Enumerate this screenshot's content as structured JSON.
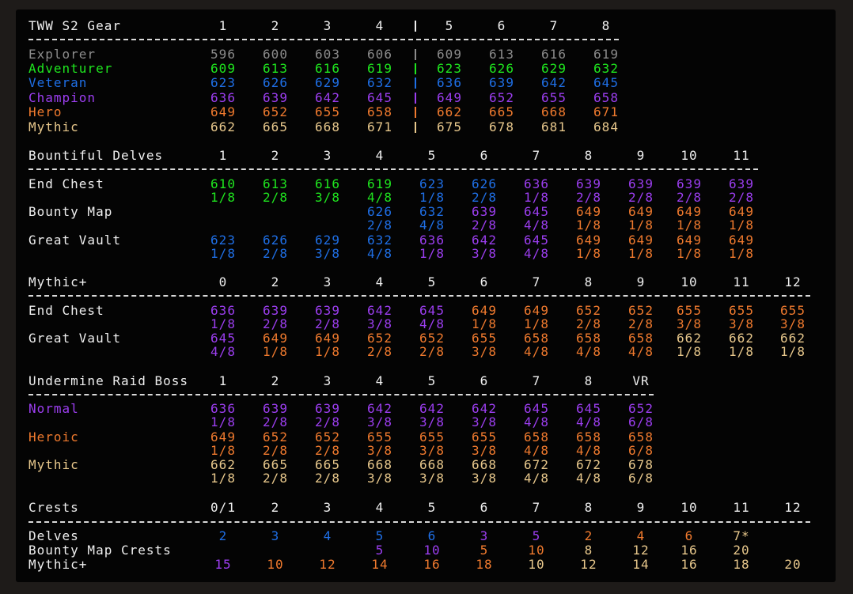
{
  "colors": {
    "header": "#efefef",
    "grey": "#8c8c8c",
    "green": "#1fe61f",
    "blue": "#1f6fe6",
    "purple": "#9c3ef0",
    "orange": "#f07a2e",
    "tan": "#e8c88c",
    "rule": "#d9d9d9"
  },
  "gear_table": {
    "title": "TWW S2 Gear",
    "columns": [
      "1",
      "2",
      "3",
      "4",
      "5",
      "6",
      "7",
      "8"
    ],
    "separator": "|",
    "rows": [
      {
        "label": "Explorer",
        "color": "grey",
        "values": [
          "596",
          "600",
          "603",
          "606",
          "609",
          "613",
          "616",
          "619"
        ]
      },
      {
        "label": "Adventurer",
        "color": "green",
        "values": [
          "609",
          "613",
          "616",
          "619",
          "623",
          "626",
          "629",
          "632"
        ]
      },
      {
        "label": "Veteran",
        "color": "blue",
        "values": [
          "623",
          "626",
          "629",
          "632",
          "636",
          "639",
          "642",
          "645"
        ]
      },
      {
        "label": "Champion",
        "color": "purple",
        "values": [
          "636",
          "639",
          "642",
          "645",
          "649",
          "652",
          "655",
          "658"
        ]
      },
      {
        "label": "Hero",
        "color": "orange",
        "values": [
          "649",
          "652",
          "655",
          "658",
          "662",
          "665",
          "668",
          "671"
        ]
      },
      {
        "label": "Mythic",
        "color": "tan",
        "values": [
          "662",
          "665",
          "668",
          "671",
          "675",
          "678",
          "681",
          "684"
        ]
      }
    ]
  },
  "delves_table": {
    "title": "Bountiful Delves",
    "columns": [
      "1",
      "2",
      "3",
      "4",
      "5",
      "6",
      "7",
      "8",
      "9",
      "10",
      "11"
    ],
    "rows": [
      {
        "label": "End Chest",
        "cells": [
          {
            "ilvl": "610",
            "track": "1/8",
            "color": "green"
          },
          {
            "ilvl": "613",
            "track": "2/8",
            "color": "green"
          },
          {
            "ilvl": "616",
            "track": "3/8",
            "color": "green"
          },
          {
            "ilvl": "619",
            "track": "4/8",
            "color": "green"
          },
          {
            "ilvl": "623",
            "track": "1/8",
            "color": "blue"
          },
          {
            "ilvl": "626",
            "track": "2/8",
            "color": "blue"
          },
          {
            "ilvl": "636",
            "track": "1/8",
            "color": "purple"
          },
          {
            "ilvl": "639",
            "track": "2/8",
            "color": "purple"
          },
          {
            "ilvl": "639",
            "track": "2/8",
            "color": "purple"
          },
          {
            "ilvl": "639",
            "track": "2/8",
            "color": "purple"
          },
          {
            "ilvl": "639",
            "track": "2/8",
            "color": "purple"
          }
        ]
      },
      {
        "label": "Bounty Map",
        "cells": [
          null,
          null,
          null,
          {
            "ilvl": "626",
            "track": "2/8",
            "color": "blue"
          },
          {
            "ilvl": "632",
            "track": "4/8",
            "color": "blue"
          },
          {
            "ilvl": "639",
            "track": "2/8",
            "color": "purple"
          },
          {
            "ilvl": "645",
            "track": "4/8",
            "color": "purple"
          },
          {
            "ilvl": "649",
            "track": "1/8",
            "color": "orange"
          },
          {
            "ilvl": "649",
            "track": "1/8",
            "color": "orange"
          },
          {
            "ilvl": "649",
            "track": "1/8",
            "color": "orange"
          },
          {
            "ilvl": "649",
            "track": "1/8",
            "color": "orange"
          }
        ]
      },
      {
        "label": "Great Vault",
        "cells": [
          {
            "ilvl": "623",
            "track": "1/8",
            "color": "blue"
          },
          {
            "ilvl": "626",
            "track": "2/8",
            "color": "blue"
          },
          {
            "ilvl": "629",
            "track": "3/8",
            "color": "blue"
          },
          {
            "ilvl": "632",
            "track": "4/8",
            "color": "blue"
          },
          {
            "ilvl": "636",
            "track": "1/8",
            "color": "purple"
          },
          {
            "ilvl": "642",
            "track": "3/8",
            "color": "purple"
          },
          {
            "ilvl": "645",
            "track": "4/8",
            "color": "purple"
          },
          {
            "ilvl": "649",
            "track": "1/8",
            "color": "orange"
          },
          {
            "ilvl": "649",
            "track": "1/8",
            "color": "orange"
          },
          {
            "ilvl": "649",
            "track": "1/8",
            "color": "orange"
          },
          {
            "ilvl": "649",
            "track": "1/8",
            "color": "orange"
          }
        ]
      }
    ]
  },
  "mplus_table": {
    "title": "Mythic+",
    "columns": [
      "0",
      "2",
      "3",
      "4",
      "5",
      "6",
      "7",
      "8",
      "9",
      "10",
      "11",
      "12"
    ],
    "rows": [
      {
        "label": "End Chest",
        "cells": [
          {
            "ilvl": "636",
            "track": "1/8",
            "color": "purple"
          },
          {
            "ilvl": "639",
            "track": "2/8",
            "color": "purple"
          },
          {
            "ilvl": "639",
            "track": "2/8",
            "color": "purple"
          },
          {
            "ilvl": "642",
            "track": "3/8",
            "color": "purple"
          },
          {
            "ilvl": "645",
            "track": "4/8",
            "color": "purple"
          },
          {
            "ilvl": "649",
            "track": "1/8",
            "color": "orange"
          },
          {
            "ilvl": "649",
            "track": "1/8",
            "color": "orange"
          },
          {
            "ilvl": "652",
            "track": "2/8",
            "color": "orange"
          },
          {
            "ilvl": "652",
            "track": "2/8",
            "color": "orange"
          },
          {
            "ilvl": "655",
            "track": "3/8",
            "color": "orange"
          },
          {
            "ilvl": "655",
            "track": "3/8",
            "color": "orange"
          },
          {
            "ilvl": "655",
            "track": "3/8",
            "color": "orange"
          }
        ]
      },
      {
        "label": "Great Vault",
        "cells": [
          {
            "ilvl": "645",
            "track": "4/8",
            "color": "purple"
          },
          {
            "ilvl": "649",
            "track": "1/8",
            "color": "orange"
          },
          {
            "ilvl": "649",
            "track": "1/8",
            "color": "orange"
          },
          {
            "ilvl": "652",
            "track": "2/8",
            "color": "orange"
          },
          {
            "ilvl": "652",
            "track": "2/8",
            "color": "orange"
          },
          {
            "ilvl": "655",
            "track": "3/8",
            "color": "orange"
          },
          {
            "ilvl": "658",
            "track": "4/8",
            "color": "orange"
          },
          {
            "ilvl": "658",
            "track": "4/8",
            "color": "orange"
          },
          {
            "ilvl": "658",
            "track": "4/8",
            "color": "orange"
          },
          {
            "ilvl": "662",
            "track": "1/8",
            "color": "tan"
          },
          {
            "ilvl": "662",
            "track": "1/8",
            "color": "tan"
          },
          {
            "ilvl": "662",
            "track": "1/8",
            "color": "tan"
          }
        ]
      }
    ]
  },
  "raid_table": {
    "title": "Undermine Raid Boss",
    "columns": [
      "1",
      "2",
      "3",
      "4",
      "5",
      "6",
      "7",
      "8",
      "VR"
    ],
    "rows": [
      {
        "label": "Normal",
        "label_color": "purple",
        "color": "purple",
        "ilvls": [
          "636",
          "639",
          "639",
          "642",
          "642",
          "642",
          "645",
          "645",
          "652"
        ],
        "tracks": [
          "1/8",
          "2/8",
          "2/8",
          "3/8",
          "3/8",
          "3/8",
          "4/8",
          "4/8",
          "6/8"
        ]
      },
      {
        "label": "Heroic",
        "label_color": "orange",
        "color": "orange",
        "ilvls": [
          "649",
          "652",
          "652",
          "655",
          "655",
          "655",
          "658",
          "658",
          "658"
        ],
        "tracks": [
          "1/8",
          "2/8",
          "2/8",
          "3/8",
          "3/8",
          "3/8",
          "4/8",
          "4/8",
          "6/8"
        ]
      },
      {
        "label": "Mythic",
        "label_color": "tan",
        "color": "tan",
        "ilvls": [
          "662",
          "665",
          "665",
          "668",
          "668",
          "668",
          "672",
          "672",
          "678"
        ],
        "tracks": [
          "1/8",
          "2/8",
          "2/8",
          "3/8",
          "3/8",
          "3/8",
          "4/8",
          "4/8",
          "6/8"
        ]
      }
    ]
  },
  "crests_table": {
    "title": "Crests",
    "columns": [
      "0/1",
      "2",
      "3",
      "4",
      "5",
      "6",
      "7",
      "8",
      "9",
      "10",
      "11",
      "12"
    ],
    "rows": [
      {
        "label": "Delves",
        "cells": [
          {
            "v": "2",
            "color": "blue"
          },
          {
            "v": "3",
            "color": "blue"
          },
          {
            "v": "4",
            "color": "blue"
          },
          {
            "v": "5",
            "color": "blue"
          },
          {
            "v": "6",
            "color": "blue"
          },
          {
            "v": "3",
            "color": "purple"
          },
          {
            "v": "5",
            "color": "purple"
          },
          {
            "v": "2",
            "color": "orange"
          },
          {
            "v": "4",
            "color": "orange"
          },
          {
            "v": "6",
            "color": "orange"
          },
          {
            "v": "7*",
            "color": "tan"
          },
          null
        ]
      },
      {
        "label": "Bounty Map Crests",
        "cells": [
          null,
          null,
          null,
          {
            "v": "5",
            "color": "purple"
          },
          {
            "v": "10",
            "color": "purple"
          },
          {
            "v": "5",
            "color": "orange"
          },
          {
            "v": "10",
            "color": "orange"
          },
          {
            "v": "8",
            "color": "tan"
          },
          {
            "v": "12",
            "color": "tan"
          },
          {
            "v": "16",
            "color": "tan"
          },
          {
            "v": "20",
            "color": "tan"
          },
          null
        ]
      },
      {
        "label": "Mythic+",
        "cells": [
          {
            "v": "15",
            "color": "purple"
          },
          {
            "v": "10",
            "color": "orange"
          },
          {
            "v": "12",
            "color": "orange"
          },
          {
            "v": "14",
            "color": "orange"
          },
          {
            "v": "16",
            "color": "orange"
          },
          {
            "v": "18",
            "color": "orange"
          },
          {
            "v": "10",
            "color": "tan"
          },
          {
            "v": "12",
            "color": "tan"
          },
          {
            "v": "14",
            "color": "tan"
          },
          {
            "v": "16",
            "color": "tan"
          },
          {
            "v": "18",
            "color": "tan"
          },
          {
            "v": "20",
            "color": "tan"
          }
        ]
      }
    ]
  }
}
